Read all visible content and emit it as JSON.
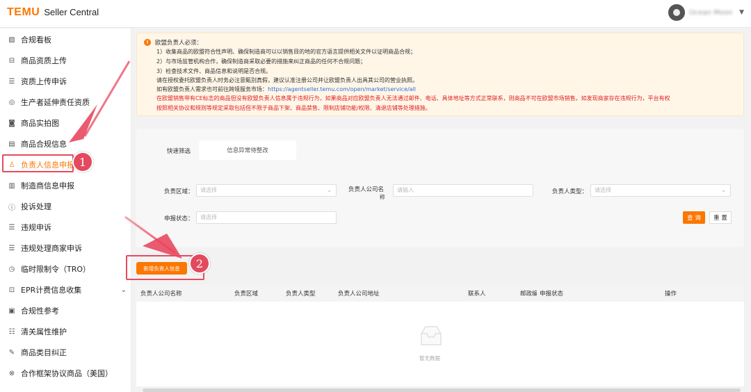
{
  "header": {
    "logo_brand": "TEMU",
    "logo_product": "Seller Central",
    "user_name": "Ocean Moon"
  },
  "sidebar": {
    "items": [
      {
        "label": "合规看板",
        "icon": "chart-icon"
      },
      {
        "label": "商品资质上传",
        "icon": "upload-icon"
      },
      {
        "label": "资质上传申诉",
        "icon": "document-icon"
      },
      {
        "label": "生产者延伸责任资质",
        "icon": "badge-icon"
      },
      {
        "label": "商品实拍图",
        "icon": "camera-icon"
      },
      {
        "label": "商品合规信息",
        "icon": "document-icon"
      },
      {
        "label": "负责人信息申报",
        "icon": "person-icon",
        "active": true
      },
      {
        "label": "制造商信息申报",
        "icon": "factory-icon"
      },
      {
        "label": "投诉处理",
        "icon": "alert-icon"
      },
      {
        "label": "违规申诉",
        "icon": "document-icon"
      },
      {
        "label": "违规处理商家申诉",
        "icon": "document-icon"
      },
      {
        "label": "临时限制令（TRO）",
        "icon": "clock-icon"
      },
      {
        "label": "EPR计费信息收集",
        "icon": "epr-icon",
        "expandable": true
      },
      {
        "label": "合规性参考",
        "icon": "book-icon"
      },
      {
        "label": "清关属性维护",
        "icon": "list-icon"
      },
      {
        "label": "商品类目纠正",
        "icon": "edit-icon"
      },
      {
        "label": "合作框架协议商品（美国）",
        "icon": "link-icon"
      }
    ]
  },
  "notice": {
    "title": "欧盟负责人必须：",
    "lines": [
      "1）收集商品的欧盟符合性声明、确保制造商可以以销售目的地的官方语言提供相关文件以证明商品合规；",
      "2）与市场监管机构合作，确保制造商采取必要的措施来纠正商品的任何不合规问题；",
      "3）检查技术文件、商品信息和说明是否合规。",
      "请在授权委托欧盟负责人时务必注意甄别真假，建议认准注册公司并让欧盟负责人出具其公司的营业执照。"
    ],
    "service_prefix": "如有欧盟负责人需求也可前往跨境服务市场：",
    "service_link": "https://agentseller.temu.com/open/market/service/all",
    "warning_line1": "在欧盟销售带有CE标志的商品但没有欧盟负责人信息属于违规行为，如果商品对应欧盟负责人无法通过邮件、电话、具体地址等方式正常联系，则商品不可在欧盟市场销售。如发现商家存在违规行为，平台有权",
    "warning_line2": "按照相关协议和规则等规定采取包括但不限于商品下架、商品禁售、限制店铺功能/权限、清退店铺等处理措施。"
  },
  "filters": {
    "quick_label": "快速筛选",
    "quick_chip": "信息异常待整改",
    "region_label": "负责区域：",
    "region_placeholder": "请选择",
    "company_label_1": "负责人公司名",
    "company_label_2": "称",
    "company_placeholder": "请输入",
    "type_label": "负责人类型：",
    "type_placeholder": "请选择",
    "status_label": "申报状态：",
    "status_placeholder": "请选择",
    "query_button": "查 询",
    "reset_button": "重 置"
  },
  "actions": {
    "add_button": "新增负责人信息"
  },
  "table": {
    "columns": [
      "负责人公司名称",
      "负责区域",
      "负责人类型",
      "负责人公司地址",
      "联系人",
      "邮政编",
      "申报状态",
      "操作"
    ],
    "empty_text": "暂无数据"
  },
  "annotations": {
    "badge_1": "1",
    "badge_2": "2",
    "color": "#e8495f"
  },
  "colors": {
    "accent": "#fb7701",
    "warning": "#e02020",
    "link": "#2f6fd9"
  }
}
